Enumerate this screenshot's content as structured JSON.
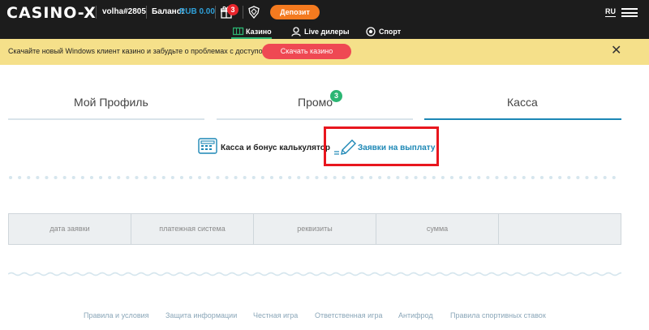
{
  "header": {
    "logo": "CASINO-X",
    "username": "volha#2805",
    "balance_label": "Баланс:",
    "balance_value": "RUB 0.00",
    "gifts_count": "3",
    "deposit_label": "Депозит",
    "language": "RU",
    "icons": [
      "gift-icon",
      "shield-icon",
      "menu-icon"
    ]
  },
  "subnav": {
    "tabs": [
      {
        "label": "Казино",
        "icon": "slot-icon",
        "active": true
      },
      {
        "label": "Live дилеры",
        "icon": "dealer-icon",
        "active": false
      },
      {
        "label": "Спорт",
        "icon": "ball-icon",
        "active": false
      }
    ]
  },
  "notice": {
    "text": "Скачайте новый Windows клиент казино и забудьте о проблемах с доступом",
    "button_label": "Скачать казино",
    "close": "✕"
  },
  "profile_tabs": [
    {
      "label": "Мой Профиль"
    },
    {
      "label": "Промо",
      "badge": "3"
    },
    {
      "label": "Касса",
      "active": true
    }
  ],
  "cash_links": {
    "calculator_label": "Касса и бонус калькулятор",
    "payout_label": "Заявки на выплату"
  },
  "table": {
    "headers": [
      "дата заявки",
      "платежная система",
      "реквизиты",
      "сумма",
      ""
    ]
  },
  "footer": {
    "links": [
      "Правила и условия",
      "Защита информации",
      "Честная игра",
      "Ответственная игра",
      "Антифрод",
      "Правила спортивных ставок"
    ]
  },
  "colors": {
    "header_bg": "#1c1c1c",
    "accent_orange": "#f47a1f",
    "accent_green": "#2bb673",
    "accent_blue": "#1c87b5",
    "notice_bg": "#f5e08a",
    "notice_button": "#ef4853",
    "highlight": "#e8161e"
  }
}
